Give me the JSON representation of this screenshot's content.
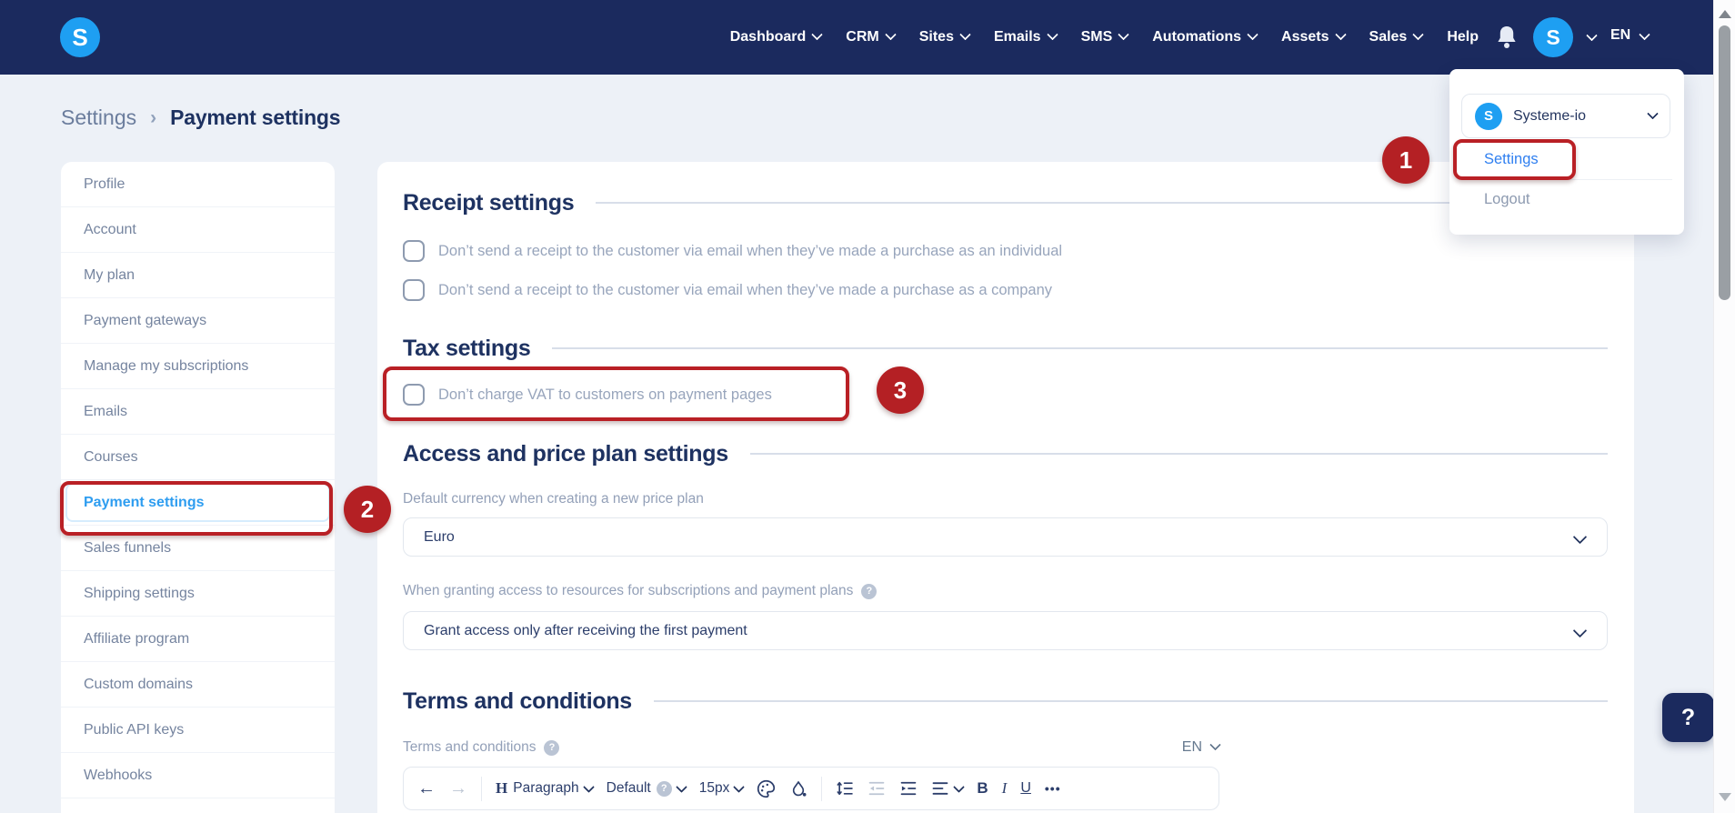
{
  "colors": {
    "header_bg": "#1b2a5e",
    "page_bg": "#edf1f7",
    "accent_blue": "#1e9ff2",
    "link_blue": "#2f7ff0",
    "active_item_blue": "#2e9df0",
    "heading_navy": "#1e3261",
    "annotation_red": "#b92025"
  },
  "icons": {
    "question_mark": "?",
    "undo": "←",
    "redo": "→",
    "more": "•••",
    "breadcrumb_separator": "›"
  },
  "header": {
    "logo_letter": "S",
    "nav": [
      {
        "label": "Dashboard",
        "has_chevron": true
      },
      {
        "label": "CRM",
        "has_chevron": true
      },
      {
        "label": "Sites",
        "has_chevron": true
      },
      {
        "label": "Emails",
        "has_chevron": true
      },
      {
        "label": "SMS",
        "has_chevron": true
      },
      {
        "label": "Automations",
        "has_chevron": true
      },
      {
        "label": "Assets",
        "has_chevron": true
      },
      {
        "label": "Sales",
        "has_chevron": true
      },
      {
        "label": "Help",
        "has_chevron": false
      }
    ],
    "avatar_letter": "S",
    "language": "EN"
  },
  "breadcrumb": {
    "parent": "Settings",
    "current": "Payment settings"
  },
  "account_menu": {
    "avatar_letter": "S",
    "account_name": "Systeme-io",
    "settings_label": "Settings",
    "logout_label": "Logout"
  },
  "annotations": {
    "step_1": "1",
    "step_2": "2",
    "step_3": "3"
  },
  "sidebar": {
    "items": [
      {
        "label": "Profile",
        "active": false
      },
      {
        "label": "Account",
        "active": false
      },
      {
        "label": "My plan",
        "active": false
      },
      {
        "label": "Payment gateways",
        "active": false
      },
      {
        "label": "Manage my subscriptions",
        "active": false
      },
      {
        "label": "Emails",
        "active": false
      },
      {
        "label": "Courses",
        "active": false
      },
      {
        "label": "Payment settings",
        "active": true
      },
      {
        "label": "Sales funnels",
        "active": false
      },
      {
        "label": "Shipping settings",
        "active": false
      },
      {
        "label": "Affiliate program",
        "active": false
      },
      {
        "label": "Custom domains",
        "active": false
      },
      {
        "label": "Public API keys",
        "active": false
      },
      {
        "label": "Webhooks",
        "active": false
      }
    ]
  },
  "receipt_section": {
    "title": "Receipt settings",
    "checkboxes": [
      {
        "label": "Don’t send a receipt to the customer via email when they’ve made a purchase as an individual",
        "checked": false
      },
      {
        "label": "Don’t send a receipt to the customer via email when they’ve made a purchase as a company",
        "checked": false
      }
    ]
  },
  "tax_section": {
    "title": "Tax settings",
    "checkbox_label": "Don’t charge VAT to customers on payment pages",
    "checked": false
  },
  "access_section": {
    "title": "Access and price plan settings",
    "currency_label": "Default currency when creating a new price plan",
    "currency_value": "Euro",
    "grant_label": "When granting access to resources for subscriptions and payment plans",
    "grant_value": "Grant access only after receiving the first payment"
  },
  "terms_section": {
    "title": "Terms and conditions",
    "field_label": "Terms and conditions",
    "language_value": "EN",
    "toolbar": {
      "heading_glyph": "H",
      "paragraph": "Paragraph",
      "font_family": "Default",
      "font_size": "15px",
      "bold": "B",
      "italic": "I",
      "underline": "U"
    }
  },
  "help_button": {
    "label": "?"
  }
}
